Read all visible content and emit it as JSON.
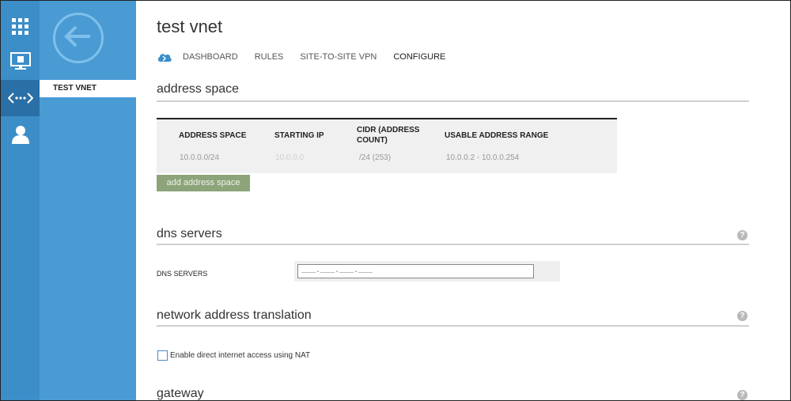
{
  "rail": {
    "items": [
      {
        "icon": "grid-icon"
      },
      {
        "icon": "monitor-icon"
      },
      {
        "icon": "network-icon"
      },
      {
        "icon": "user-icon"
      }
    ]
  },
  "subnav": {
    "back_icon": "back-arrow-icon",
    "items": [
      {
        "label": "TEST VNET"
      }
    ]
  },
  "page": {
    "title": "test vnet"
  },
  "tabs": [
    {
      "label": "DASHBOARD"
    },
    {
      "label": "RULES"
    },
    {
      "label": "SITE-TO-SITE VPN"
    },
    {
      "label": "CONFIGURE"
    }
  ],
  "address_space": {
    "title": "address space",
    "headers": [
      "ADDRESS SPACE",
      "STARTING IP",
      "CIDR (ADDRESS",
      "COUNT)",
      "USABLE ADDRESS RANGE"
    ],
    "row": {
      "address_space": "10.0.0.0/24",
      "starting_ip": "10.0.0.0",
      "cidr": "/24 (253)",
      "usable_range": "10.0.0.2 - 10.0.0.254"
    },
    "add_button": "add address space"
  },
  "dns": {
    "title": "dns servers",
    "label": "DNS SERVERS",
    "placeholder": "___.___.___.___"
  },
  "nat": {
    "title": "network address translation",
    "checkbox_label": "Enable direct internet access using NAT"
  },
  "gateway": {
    "title": "gateway"
  },
  "help_glyph": "?",
  "colors": {
    "rail": "#3c8ec8",
    "subnav": "#4a9bd4",
    "add_button": "#8da47a"
  }
}
